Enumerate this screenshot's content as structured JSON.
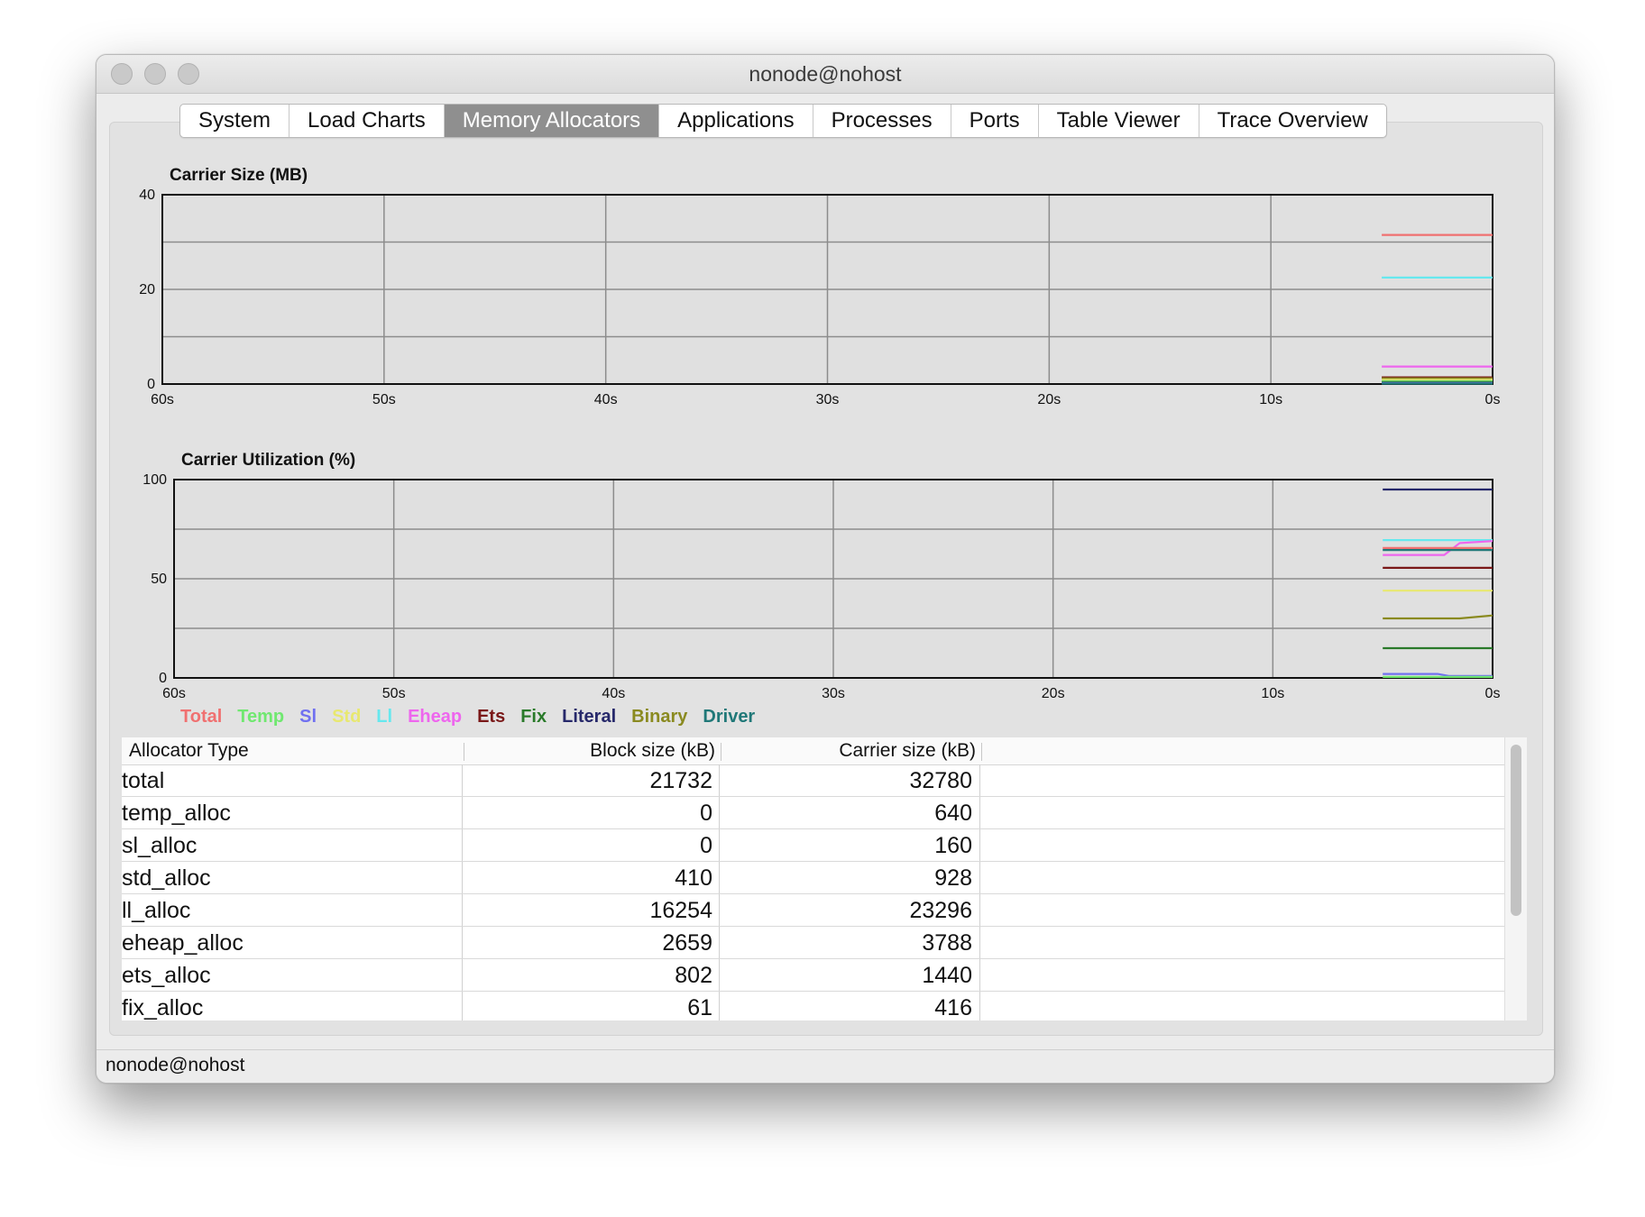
{
  "window": {
    "title": "nonode@nohost"
  },
  "tabs": [
    {
      "label": "System",
      "active": false
    },
    {
      "label": "Load Charts",
      "active": false
    },
    {
      "label": "Memory Allocators",
      "active": true
    },
    {
      "label": "Applications",
      "active": false
    },
    {
      "label": "Processes",
      "active": false
    },
    {
      "label": "Ports",
      "active": false
    },
    {
      "label": "Table Viewer",
      "active": false
    },
    {
      "label": "Trace Overview",
      "active": false
    }
  ],
  "chart_data": [
    {
      "type": "line",
      "title": "Carrier Size (MB)",
      "x_ticks": [
        "60s",
        "50s",
        "40s",
        "30s",
        "20s",
        "10s",
        "0s"
      ],
      "y_ticks": [
        "0",
        "20",
        "40"
      ],
      "ylim": [
        0,
        40
      ],
      "xlim": [
        -60,
        0
      ],
      "series": [
        {
          "name": "Total",
          "color": "#f07070",
          "x": [
            -5,
            0
          ],
          "values": [
            31.5,
            31.5
          ]
        },
        {
          "name": "Ll",
          "color": "#66e8ee",
          "x": [
            -5,
            0
          ],
          "values": [
            22.5,
            22.5
          ]
        },
        {
          "name": "Eheap",
          "color": "#ee66ee",
          "x": [
            -5,
            0
          ],
          "values": [
            3.7,
            3.7
          ]
        },
        {
          "name": "Ets",
          "color": "#7a1818",
          "x": [
            -5,
            0
          ],
          "values": [
            1.4,
            1.4
          ]
        },
        {
          "name": "Binary",
          "color": "#8a8a20",
          "x": [
            -5,
            0
          ],
          "values": [
            1.2,
            1.2
          ]
        },
        {
          "name": "Std",
          "color": "#e8e870",
          "x": [
            -5,
            0
          ],
          "values": [
            0.9,
            0.9
          ]
        },
        {
          "name": "Temp",
          "color": "#70e870",
          "x": [
            -5,
            0
          ],
          "values": [
            0.6,
            0.6
          ]
        },
        {
          "name": "Fix",
          "color": "#2a7a2a",
          "x": [
            -5,
            0
          ],
          "values": [
            0.4,
            0.4
          ]
        },
        {
          "name": "Sl",
          "color": "#7070f0",
          "x": [
            -5,
            0
          ],
          "values": [
            0.2,
            0.2
          ]
        },
        {
          "name": "Driver",
          "color": "#207878",
          "x": [
            -5,
            0
          ],
          "values": [
            0.1,
            0.1
          ]
        }
      ]
    },
    {
      "type": "line",
      "title": "Carrier Utilization (%)",
      "x_ticks": [
        "60s",
        "50s",
        "40s",
        "30s",
        "20s",
        "10s",
        "0s"
      ],
      "y_ticks": [
        "0",
        "50",
        "100"
      ],
      "ylim": [
        0,
        100
      ],
      "xlim": [
        -60,
        0
      ],
      "series": [
        {
          "name": "Literal",
          "color": "#26286a",
          "x": [
            -5,
            0
          ],
          "values": [
            95,
            95
          ]
        },
        {
          "name": "Ll",
          "color": "#66e8ee",
          "x": [
            -5,
            -1.5,
            0
          ],
          "values": [
            69.5,
            69.5,
            69.5
          ]
        },
        {
          "name": "Eheap",
          "color": "#ee66ee",
          "x": [
            -5,
            -2.2,
            -1.5,
            0
          ],
          "values": [
            62,
            62,
            68,
            69
          ]
        },
        {
          "name": "Total",
          "color": "#f07070",
          "x": [
            -5,
            0
          ],
          "values": [
            65.5,
            65.5
          ]
        },
        {
          "name": "Driver",
          "color": "#207878",
          "x": [
            -5,
            0
          ],
          "values": [
            64.5,
            64.5
          ]
        },
        {
          "name": "Ets",
          "color": "#7a1818",
          "x": [
            -5,
            0
          ],
          "values": [
            55.5,
            55.5
          ]
        },
        {
          "name": "Std",
          "color": "#e8e870",
          "x": [
            -5,
            0
          ],
          "values": [
            44,
            44
          ]
        },
        {
          "name": "Binary",
          "color": "#8a8a20",
          "x": [
            -5,
            -1.5,
            0
          ],
          "values": [
            30,
            30,
            31.5
          ]
        },
        {
          "name": "Fix",
          "color": "#2a7a2a",
          "x": [
            -5,
            0
          ],
          "values": [
            15,
            15
          ]
        },
        {
          "name": "Sl",
          "color": "#7070f0",
          "x": [
            -5,
            -2.5,
            -2,
            0
          ],
          "values": [
            2,
            2,
            1,
            1
          ]
        },
        {
          "name": "Temp",
          "color": "#70e870",
          "x": [
            -5,
            0
          ],
          "values": [
            0.5,
            0.5
          ]
        }
      ]
    }
  ],
  "legend": [
    {
      "label": "Total",
      "color": "#f07070"
    },
    {
      "label": "Temp",
      "color": "#70e870"
    },
    {
      "label": "Sl",
      "color": "#7070f0"
    },
    {
      "label": "Std",
      "color": "#e8e870"
    },
    {
      "label": "Ll",
      "color": "#66e8ee"
    },
    {
      "label": "Eheap",
      "color": "#ee66ee"
    },
    {
      "label": "Ets",
      "color": "#7a1818"
    },
    {
      "label": "Fix",
      "color": "#2a7a2a"
    },
    {
      "label": "Literal",
      "color": "#26286a"
    },
    {
      "label": "Binary",
      "color": "#8a8a20"
    },
    {
      "label": "Driver",
      "color": "#207878"
    }
  ],
  "table": {
    "headers": [
      "Allocator Type",
      "Block size (kB)",
      "Carrier size (kB)"
    ],
    "rows": [
      [
        "total",
        "21732",
        "32780"
      ],
      [
        "temp_alloc",
        "0",
        "640"
      ],
      [
        "sl_alloc",
        "0",
        "160"
      ],
      [
        "std_alloc",
        "410",
        "928"
      ],
      [
        "ll_alloc",
        "16254",
        "23296"
      ],
      [
        "eheap_alloc",
        "2659",
        "3788"
      ],
      [
        "ets_alloc",
        "802",
        "1440"
      ],
      [
        "fix_alloc",
        "61",
        "416"
      ]
    ]
  },
  "status": {
    "text": "nonode@nohost"
  }
}
